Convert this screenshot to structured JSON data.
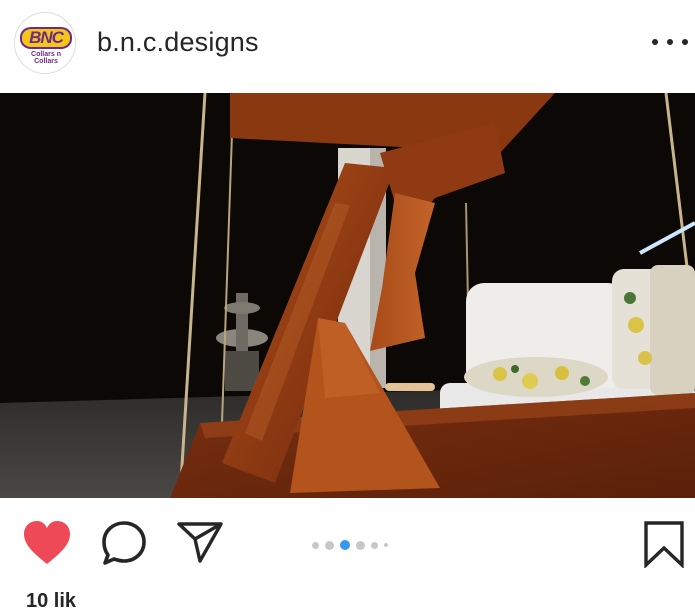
{
  "post": {
    "username": "b.n.c.designs",
    "avatar_logo_text": "BNC",
    "avatar_logo_subtext": "Collars n Collars",
    "more_icon": "ellipsis-icon",
    "likes_text": "10 lik"
  },
  "media": {
    "description_icon": "photo",
    "carousel_count": 6,
    "carousel_active_index": 2
  },
  "actions": {
    "like_icon": "heart-icon",
    "comment_icon": "comment-bubble-icon",
    "share_icon": "paper-plane-icon",
    "save_icon": "bookmark-icon",
    "like_color": "#ed4956",
    "carousel_active_color": "#3897f0"
  }
}
